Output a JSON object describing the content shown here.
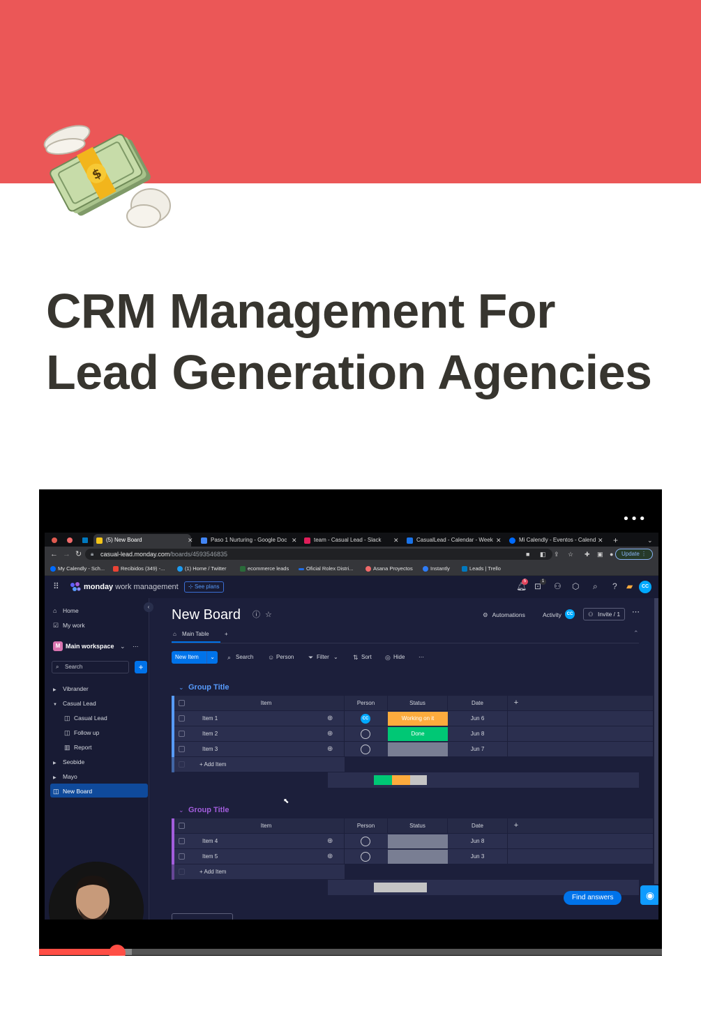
{
  "page": {
    "title": "CRM Management For Lead Generation Agencies",
    "icon": "money-with-wings-emoji",
    "cover_color": "#eb5757"
  },
  "video": {
    "menu": "•••",
    "progress_fraction": 0.125,
    "buffered_fraction": 0.149
  },
  "browser": {
    "tabs": [
      {
        "label": "(5) New Board",
        "active": true
      },
      {
        "label": "Paso 1 Nurturing - Google Doc"
      },
      {
        "label": "team - Casual Lead - Slack"
      },
      {
        "label": "CasualLead - Calendar - Week"
      },
      {
        "label": "Mi Calendly - Eventos - Calend"
      }
    ],
    "new_tab": "+",
    "url_host": "casual-lead.monday.com",
    "url_path": "/boards/4593546835",
    "update_label": "Update",
    "bookmarks": [
      "My Calendly - Sch...",
      "Recibidos (349) -...",
      "(1) Home / Twitter",
      "ecommerce leads",
      "Oficial Rolex Distri...",
      "Asana Proyectos",
      "Instantly",
      "Leads | Trello"
    ]
  },
  "monday": {
    "brand_bold": "monday",
    "brand_rest": " work management",
    "see_plans": "See plans",
    "notification_count": "5",
    "inbox_count": "1",
    "user_initials": "CC",
    "sidebar": {
      "home": "Home",
      "my_work": "My work",
      "workspace_badge": "M",
      "workspace": "Main workspace",
      "search": "Search",
      "items": [
        "Vibrander",
        "Casual Lead",
        "Casual Lead",
        "Follow up",
        "Report",
        "Seobide",
        "Mayo",
        "New Board"
      ]
    },
    "board": {
      "title": "New Board",
      "automations": "Automations",
      "activity": "Activity",
      "invite": "Invite / 1",
      "view_tab": "Main Table",
      "toolbar": {
        "new_item": "New Item",
        "search": "Search",
        "person": "Person",
        "filter": "Filter",
        "sort": "Sort",
        "hide": "Hide"
      },
      "columns": [
        "Item",
        "Person",
        "Status",
        "Date"
      ],
      "add_item": "+ Add Item",
      "groups": [
        {
          "title": "Group Title",
          "color": "#579bfc",
          "rows": [
            {
              "item": "Item 1",
              "person": "CC",
              "status": "Working on it",
              "status_color": "#fdab3d",
              "date": "Jun 6"
            },
            {
              "item": "Item 2",
              "person": "",
              "status": "Done",
              "status_color": "#00c875",
              "date": "Jun 8"
            },
            {
              "item": "Item 3",
              "person": "",
              "status": "",
              "status_color": "#797e93",
              "date": "Jun 7"
            }
          ]
        },
        {
          "title": "Group Title",
          "color": "#a25ddc",
          "rows": [
            {
              "item": "Item 4",
              "person": "",
              "status": "",
              "status_color": "#797e93",
              "date": "Jun 8"
            },
            {
              "item": "Item 5",
              "person": "",
              "status": "",
              "status_color": "#797e93",
              "date": "Jun 3"
            }
          ]
        }
      ]
    },
    "find_answers": "Find answers"
  }
}
